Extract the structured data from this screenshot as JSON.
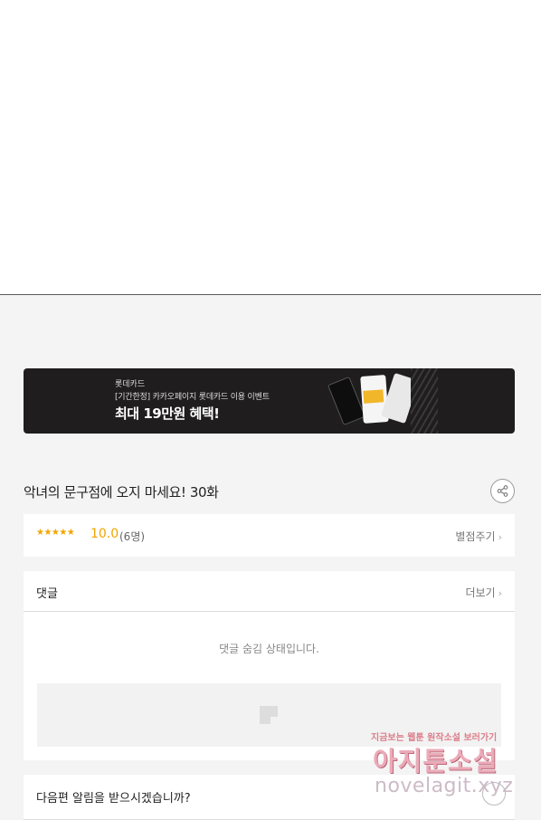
{
  "banner": {
    "brand": "롯데카드",
    "subtitle": "[기간한정] 카카오페이지 롯데카드 이용 이벤트",
    "headline": "최대 19만원 혜택!"
  },
  "episode": {
    "title": "악녀의 문구점에 오지 마세요! 30화"
  },
  "rating": {
    "stars": "★★★★★",
    "score": "10.0",
    "count": "(6명)",
    "rate_link": "별점주기"
  },
  "comments": {
    "label": "댓글",
    "more_link": "더보기",
    "hidden_message": "댓글 숨김 상태입니다."
  },
  "notify": {
    "question": "다음편 알림을 받으시겠습니까?"
  },
  "watermark": {
    "top_line": "지금보는 웹툰 원작소설 보러가기",
    "big_text": "아지툰소설",
    "url": "novelagit.xyz"
  },
  "icons": {
    "share": "share-icon",
    "chevron": "chevron-right-icon",
    "ad": "ad-placeholder-icon",
    "bell": "bell-icon"
  }
}
